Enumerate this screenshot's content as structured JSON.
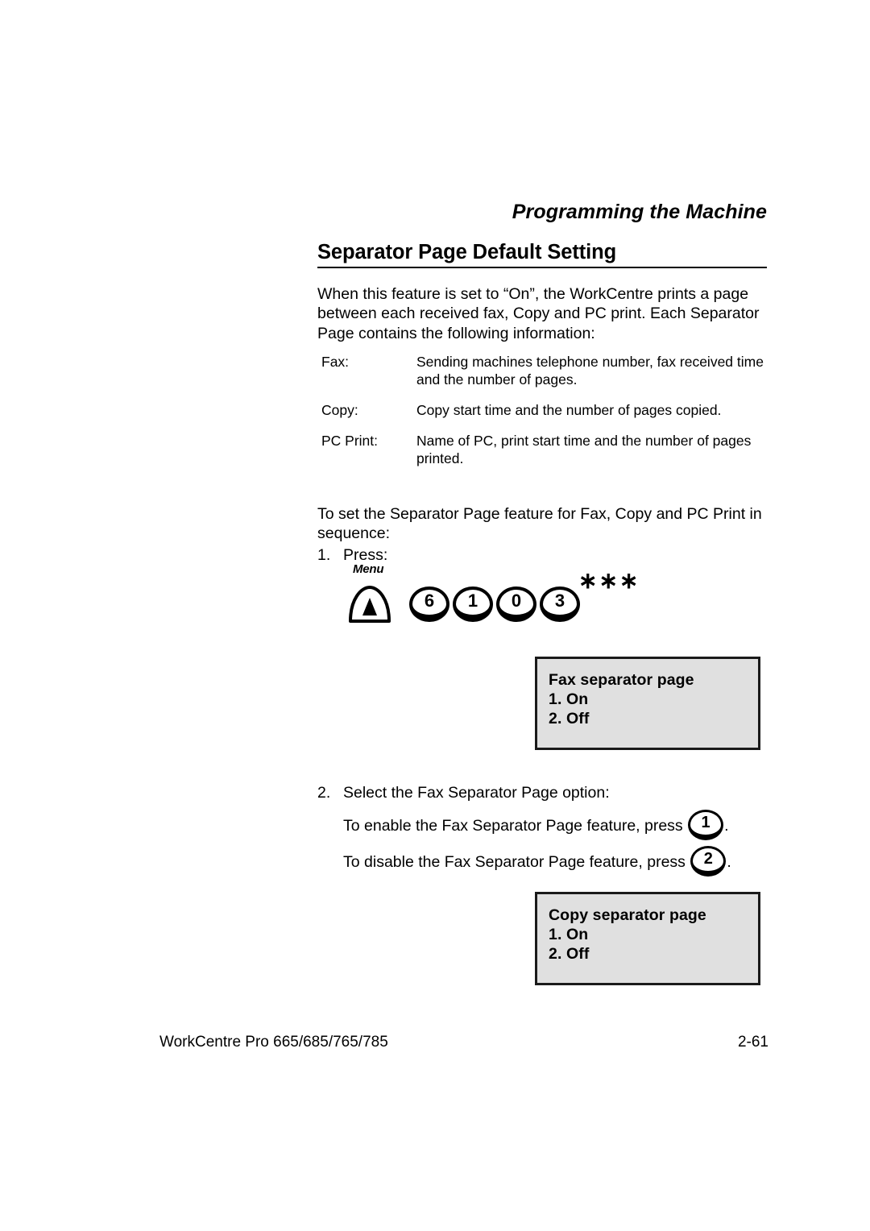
{
  "running_head": "Programming the Machine",
  "section": {
    "title": "Separator Page Default Setting",
    "intro": "When this feature is set to “On”, the WorkCentre prints a page between each received fax, Copy and PC print. Each Separator Page contains the following information:"
  },
  "definitions": [
    {
      "term": "Fax:",
      "description": "Sending machines telephone number, fax received time and the number of pages."
    },
    {
      "term": "Copy:",
      "description": "Copy start time and the number of pages copied."
    },
    {
      "term": "PC Print:",
      "description": "Name of PC, print start time and the number of pages printed."
    }
  ],
  "procedure": {
    "lead_in": "To set the Separator Page feature for Fax, Copy and PC Print in sequence:",
    "steps": [
      {
        "number": "1.",
        "text": "Press:"
      },
      {
        "number": "2.",
        "text": "Select the Fax Separator Page option:"
      }
    ],
    "substeps": [
      {
        "before": "To enable the Fax Separator Page feature, press",
        "key": "1",
        "after": "."
      },
      {
        "before": "To disable the Fax Separator Page feature, press",
        "key": "2",
        "after": "."
      }
    ]
  },
  "key_sequence": {
    "menu_label": "Menu",
    "menu_icon": "menu-up-triangle-key",
    "keys": [
      "6",
      "1",
      "0",
      "3"
    ],
    "trailing_marker": "∗∗∗"
  },
  "displays": [
    {
      "id": "fax",
      "lines": [
        "Fax separator page",
        "1. On",
        "2. Off"
      ]
    },
    {
      "id": "copy",
      "lines": [
        "Copy separator page",
        "1. On",
        "2. Off"
      ]
    }
  ],
  "footer": {
    "product": "WorkCentre Pro 665/685/765/785",
    "page_number": "2-61"
  },
  "colors": {
    "text": "#000000",
    "page_background": "#ffffff",
    "lcd_background": "#e0e0e0",
    "lcd_border": "#1a1a1a"
  }
}
